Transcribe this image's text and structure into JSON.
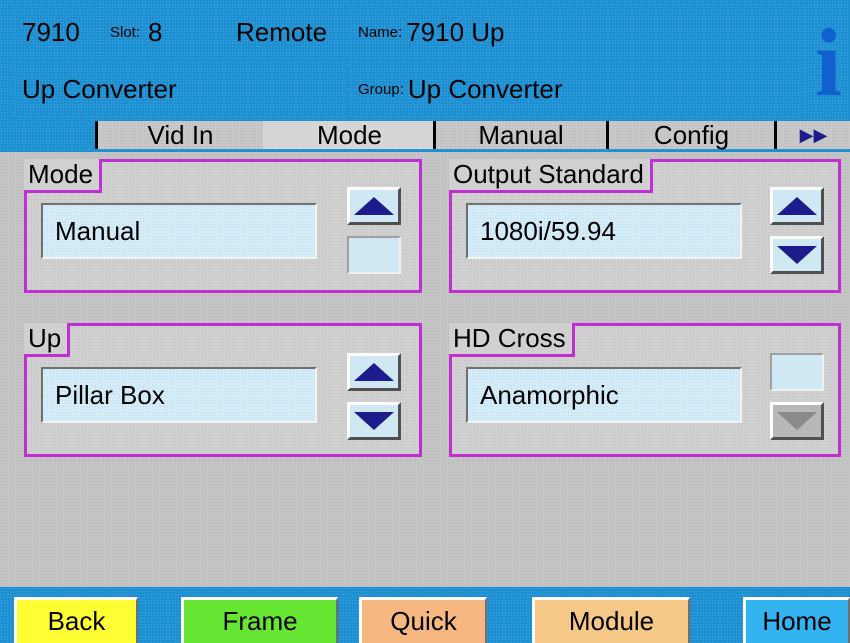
{
  "header": {
    "model": "7910",
    "slot_label": "Slot:",
    "slot_value": "8",
    "remote": "Remote",
    "name_label": "Name:",
    "name_value": "7910 Up",
    "description": "Up Converter",
    "group_label": "Group:",
    "group_value": "Up Converter",
    "info_icon": "i"
  },
  "tabs": [
    {
      "label": "Vid In",
      "active": false
    },
    {
      "label": "Mode",
      "active": true
    },
    {
      "label": "Manual",
      "active": false
    },
    {
      "label": "Config",
      "active": false
    }
  ],
  "tab_more": "▶▶",
  "panels": {
    "mode": {
      "title": "Mode",
      "value": "Manual"
    },
    "output_standard": {
      "title": "Output Standard",
      "value": "1080i/59.94"
    },
    "up": {
      "title": "Up",
      "value": "Pillar Box"
    },
    "hd_cross": {
      "title": "HD Cross",
      "value": "Anamorphic"
    }
  },
  "bottom_buttons": {
    "back": "Back",
    "frame": "Frame",
    "quick": "Quick",
    "module": "Module",
    "home": "Home"
  },
  "colors": {
    "header_blue": "#1e8fd0",
    "panel_border": "#c030d0",
    "value_bg": "#d4ecf8",
    "arrow_icon": "#1c1c8c",
    "back_button": "#ffff33",
    "frame_button": "#66e633",
    "quick_button": "#f6b880",
    "module_button": "#f6c888",
    "home_button": "#33b4f0"
  }
}
